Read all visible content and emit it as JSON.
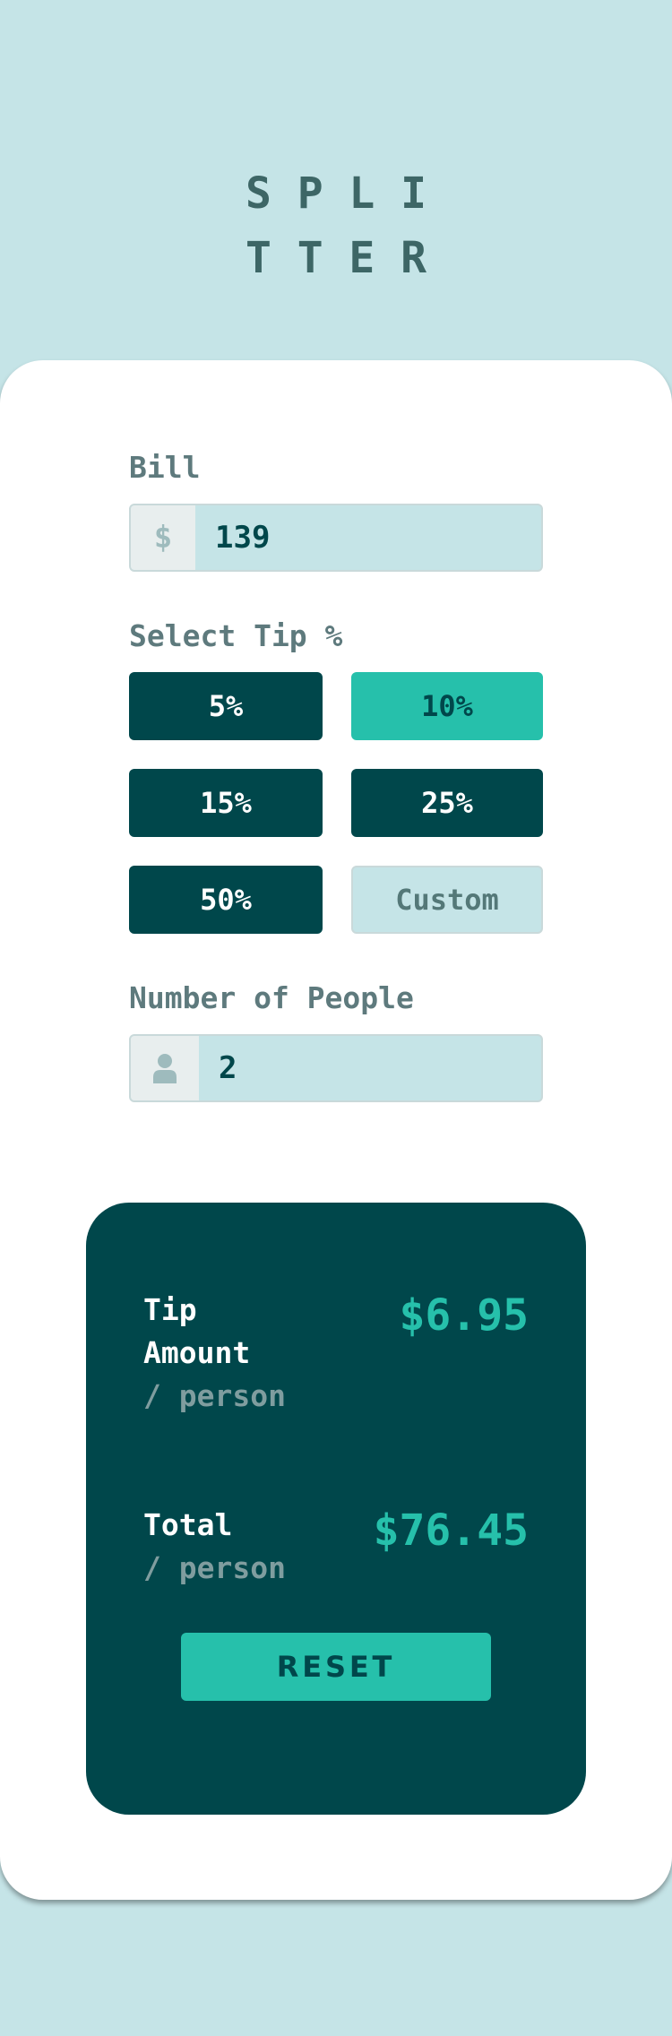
{
  "app": {
    "logo_line1": "SPLI",
    "logo_line2": "TTER"
  },
  "bill": {
    "label": "Bill",
    "currency_symbol": "$",
    "value": "139"
  },
  "tip": {
    "label": "Select Tip %",
    "options": [
      "5%",
      "10%",
      "15%",
      "25%",
      "50%"
    ],
    "selected": "10%",
    "custom_label": "Custom"
  },
  "people": {
    "label": "Number of People",
    "icon": "person-icon",
    "value": "2"
  },
  "results": {
    "tip_label_line1": "Tip",
    "tip_label_line2": "Amount",
    "tip_sub": "/ person",
    "tip_value": "$6.95",
    "total_label": "Total",
    "total_sub": "/ person",
    "total_value": "$76.45",
    "reset_label": "RESET"
  },
  "colors": {
    "background": "#c5e4e7",
    "dark_cyan": "#00474b",
    "accent": "#26c0ab"
  }
}
